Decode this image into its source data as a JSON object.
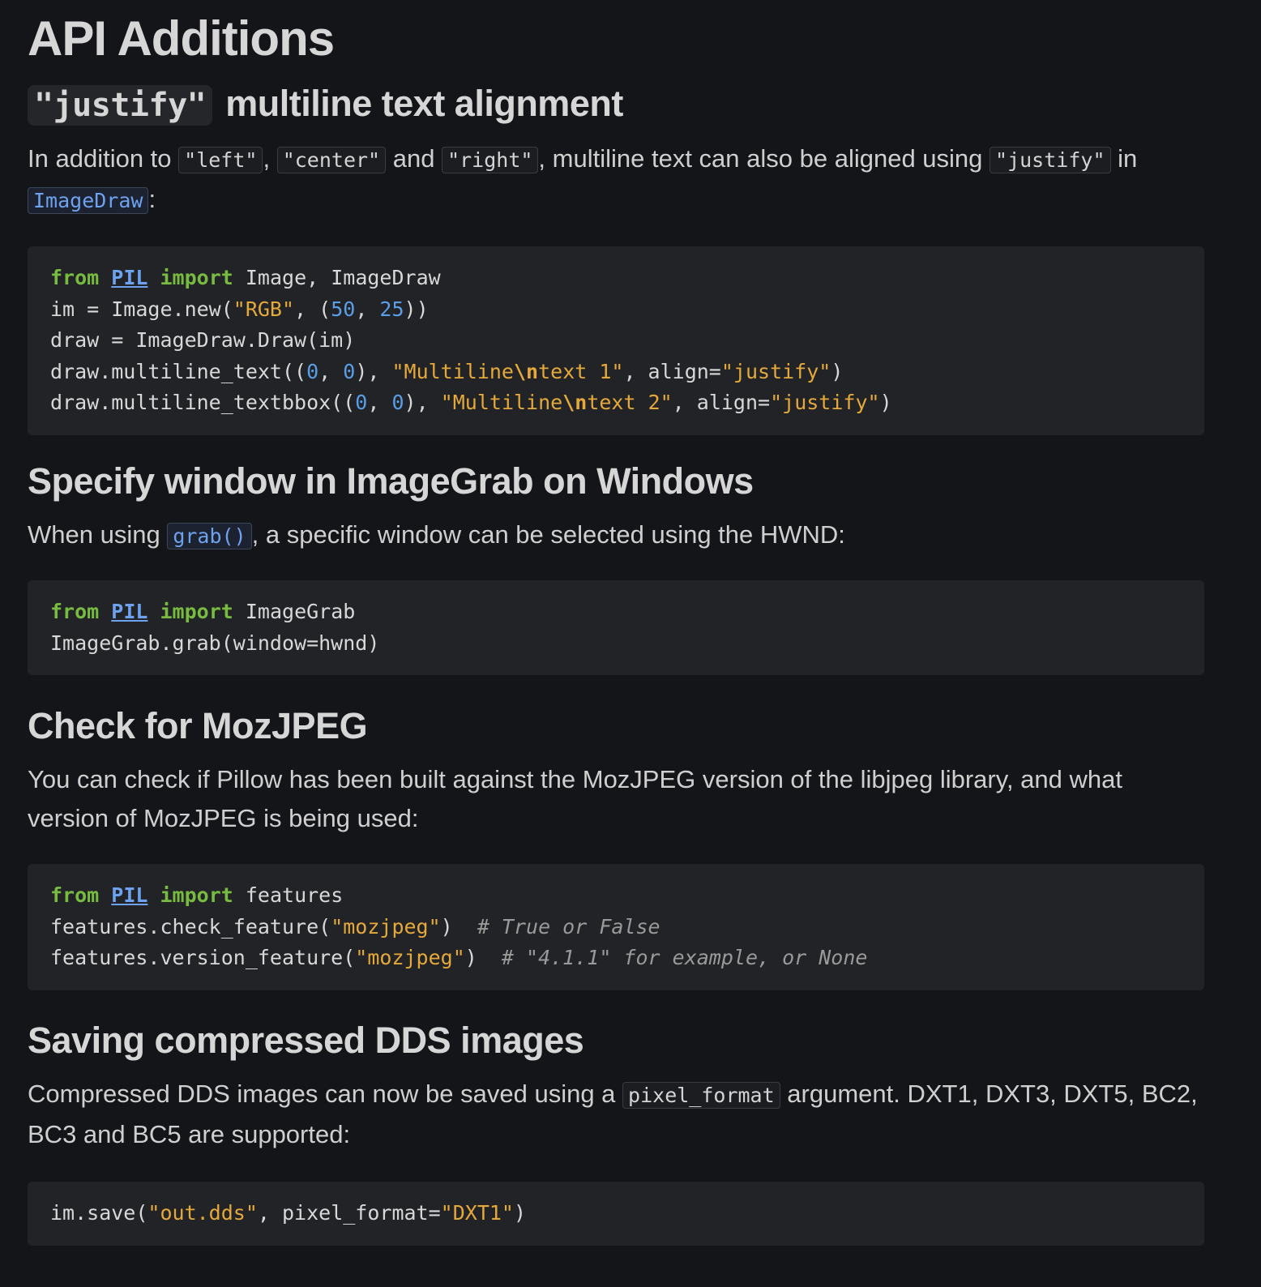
{
  "title": "API Additions",
  "justify": {
    "heading_code": "\"justify\"",
    "heading_text": "multiline text alignment",
    "intro": {
      "t1": "In addition to ",
      "c1": "\"left\"",
      "t2": ", ",
      "c2": "\"center\"",
      "t3": " and ",
      "c3": "\"right\"",
      "t4": ", multiline text can also be aligned using ",
      "c4": "\"justify\"",
      "t5": " in",
      "link": "ImageDraw",
      "t6": ":"
    },
    "code": {
      "l1": {
        "from": "from",
        "mod": "PIL",
        "imp": "import",
        "rest": " Image, ImageDraw"
      },
      "l2": {
        "a": "im = Image.new(",
        "s1": "\"RGB\"",
        "b": ", (",
        "n1": "50",
        "c": ", ",
        "n2": "25",
        "d": "))"
      },
      "l3": {
        "a": "draw = ImageDraw.Draw(im)"
      },
      "l4": {
        "a": "draw.multiline_text((",
        "n1": "0",
        "b": ", ",
        "n2": "0",
        "c": "), ",
        "s1": "\"Multiline",
        "e": "\\n",
        "s2": "text 1\"",
        "d": ", align=",
        "s3": "\"justify\"",
        "f": ")"
      },
      "l5": {
        "a": "draw.multiline_textbbox((",
        "n1": "0",
        "b": ", ",
        "n2": "0",
        "c": "), ",
        "s1": "\"Multiline",
        "e": "\\n",
        "s2": "text 2\"",
        "d": ", align=",
        "s3": "\"justify\"",
        "f": ")"
      }
    }
  },
  "imagegrab": {
    "heading": "Specify window in ImageGrab on Windows",
    "intro": {
      "t1": "When using ",
      "link": "grab()",
      "t2": ", a specific window can be selected using the HWND:"
    },
    "code": {
      "l1": {
        "from": "from",
        "mod": "PIL",
        "imp": "import",
        "rest": " ImageGrab"
      },
      "l2": {
        "a": "ImageGrab.grab(window=hwnd)"
      }
    }
  },
  "mozjpeg": {
    "heading": "Check for MozJPEG",
    "intro": "You can check if Pillow has been built against the MozJPEG version of the libjpeg library, and what version of MozJPEG is being used:",
    "code": {
      "l1": {
        "from": "from",
        "mod": "PIL",
        "imp": "import",
        "rest": " features"
      },
      "l2": {
        "a": "features.check_feature(",
        "s1": "\"mozjpeg\"",
        "b": ")  ",
        "cm": "# True or False"
      },
      "l3": {
        "a": "features.version_feature(",
        "s1": "\"mozjpeg\"",
        "b": ")  ",
        "cm": "# \"4.1.1\" for example, or None"
      }
    }
  },
  "dds": {
    "heading": "Saving compressed DDS images",
    "intro": {
      "t1": "Compressed DDS images can now be saved using a ",
      "c1": "pixel_format",
      "t2": " argument. DXT1, DXT3, DXT5, BC2, BC3 and BC5 are supported:"
    },
    "code": {
      "l1": {
        "a": "im.save(",
        "s1": "\"out.dds\"",
        "b": ", pixel_format=",
        "s2": "\"DXT1\"",
        "c": ")"
      }
    }
  },
  "colors": {
    "background": "#141518",
    "code_background": "#222326",
    "keyword": "#77bb41",
    "string": "#e5a93b",
    "number": "#5a9ee8",
    "link": "#6ea2ee",
    "comment": "#9a9a9a"
  }
}
